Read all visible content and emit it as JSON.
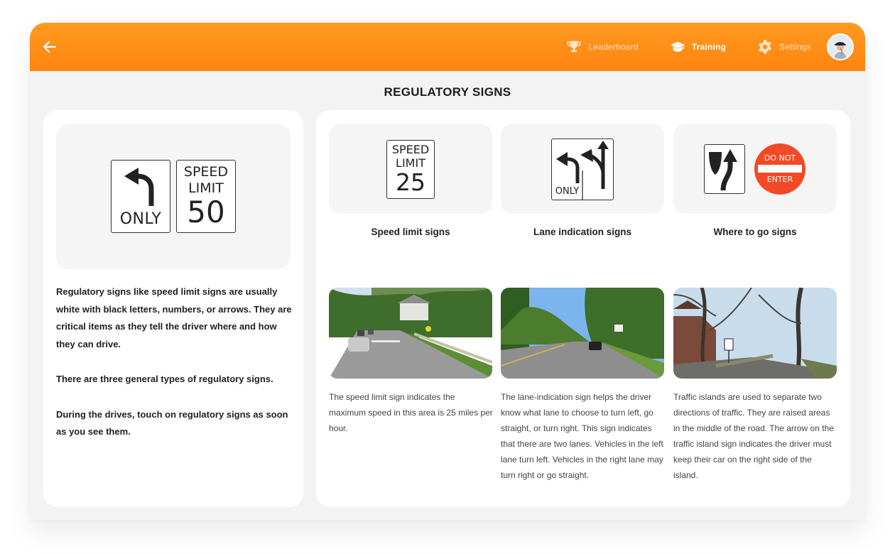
{
  "header": {
    "back_icon": "arrow-left-icon",
    "nav": [
      {
        "label": "Leaderboard",
        "icon": "trophy-icon",
        "active": false
      },
      {
        "label": "Training",
        "icon": "graduation-cap-icon",
        "active": true
      },
      {
        "label": "Settings",
        "icon": "gear-icon",
        "active": false
      }
    ],
    "avatar": "user-avatar",
    "accent_color": "#ff8c14"
  },
  "page": {
    "title": "REGULATORY SIGNS"
  },
  "intro_card": {
    "hero_signs": {
      "left_turn": {
        "text": "ONLY"
      },
      "speed": {
        "line1": "SPEED",
        "line2": "LIMIT",
        "value": "50"
      }
    },
    "paragraphs": [
      "Regulatory signs like speed limit signs are usually white with black letters, numbers, or arrows. They are critical items as they tell the driver where and how they can drive.",
      "There are three general types of regulatory signs.",
      "During the drives, touch on regulatory signs as soon as you see them."
    ]
  },
  "categories": [
    {
      "title": "Speed limit signs",
      "sign": {
        "line1": "SPEED",
        "line2": "LIMIT",
        "value": "25"
      },
      "photo": "road-photo-speed-limit",
      "description": "The speed limit sign indicates the maximum speed in this area is 25 miles per hour."
    },
    {
      "title": "Lane indication signs",
      "sign": {
        "text": "ONLY"
      },
      "photo": "road-photo-lane-indication",
      "description": "The lane-indication sign helps the driver know what lane to choose to turn left, go straight, or turn right. This sign indicates that there are two lanes. Vehicles in the left lane turn left. Vehicles in the right lane may turn right or go straight."
    },
    {
      "title": "Where to go signs",
      "sign": {
        "do_not_line1": "DO NOT",
        "do_not_line2": "ENTER",
        "do_not_color": "#f24a26"
      },
      "photo": "road-photo-traffic-island",
      "description": "Traffic islands are used to separate two directions of traffic. They are raised areas in the middle of the road. The arrow on the traffic island sign indicates the driver must keep their car on the right side of the island."
    }
  ]
}
